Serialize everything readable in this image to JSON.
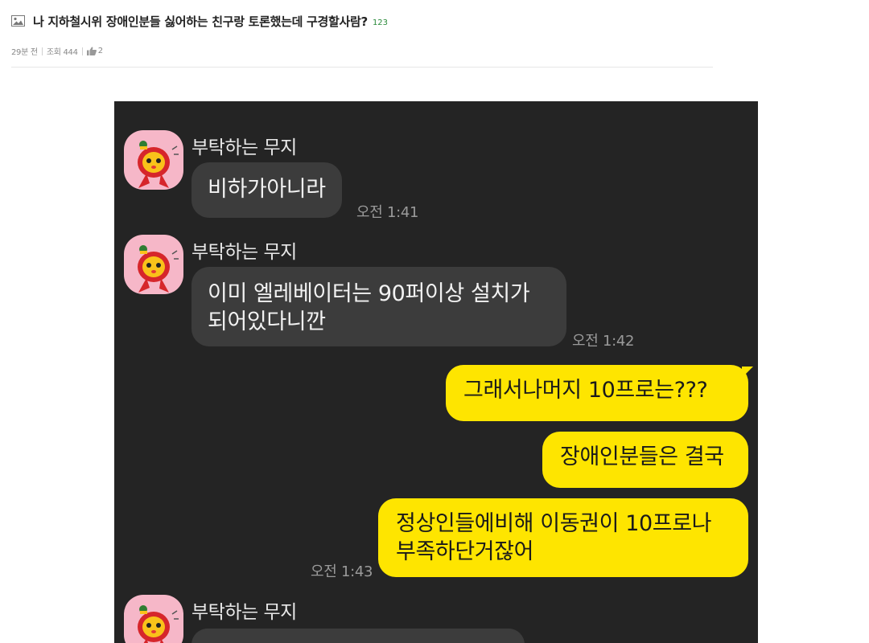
{
  "post": {
    "title": "나 지하철시위 장애인분들 싫어하는 친구랑 토론했는데 구경할사람?",
    "comment_count": "123",
    "time_ago": "29분 전",
    "views": "조회 444",
    "likes": "2"
  },
  "chat": {
    "messages": [
      {
        "sender": "부탁하는 무지",
        "text": "비하가아니라",
        "time": "오전 1:41"
      },
      {
        "sender": "부탁하는 무지",
        "lines": [
          "이미 엘레베이터는 90퍼이상 설치가",
          "되어있다니깐"
        ],
        "time": "오전 1:42"
      },
      {
        "text": "그래서나머지 10프로는???"
      },
      {
        "text": "장애인분들은 결국"
      },
      {
        "lines": [
          "정상인들에비해 이동권이 10프로나",
          "부족하단거잖어"
        ],
        "time": "오전 1:43"
      },
      {
        "sender": "부탁하는 무지"
      }
    ]
  },
  "colors": {
    "chat_bg": "#242424",
    "incoming_bubble": "#3c3c3c",
    "outgoing_bubble": "#fee500",
    "avatar_bg": "#f6b7c8",
    "comment_count": "#2a8a3a"
  },
  "icons": {
    "title_icon": "image-icon",
    "like_icon": "thumbs-up-icon",
    "avatar": "muji-character-avatar"
  }
}
